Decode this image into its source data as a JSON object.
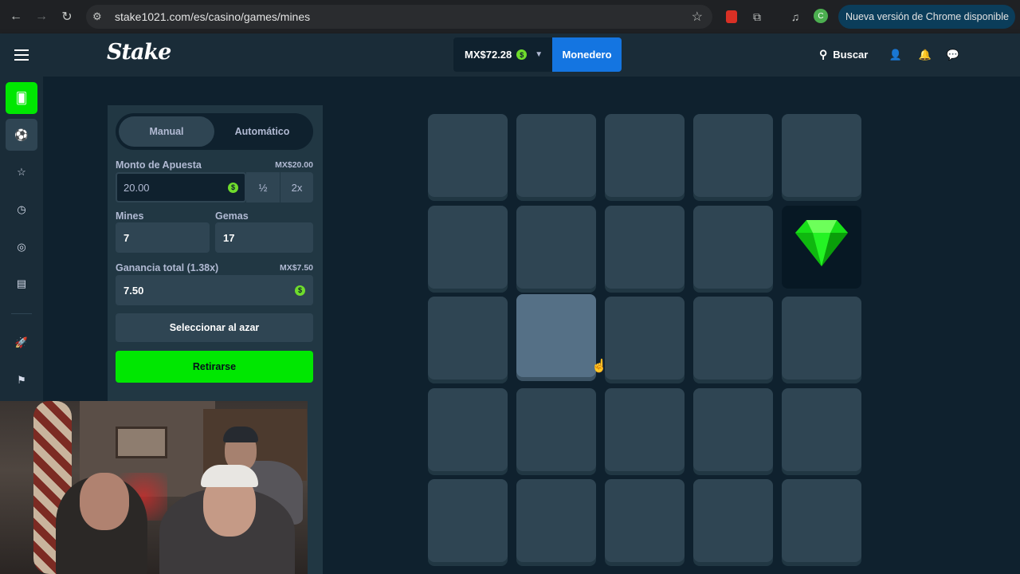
{
  "browser": {
    "url": "stake1021.com/es/casino/games/mines",
    "profile_initial": "C",
    "update_label": "Nueva versión de Chrome disponible"
  },
  "header": {
    "logo": "Stake",
    "balance": "MX$72.28",
    "wallet_label": "Monedero",
    "search_label": "Buscar"
  },
  "bet_panel": {
    "tabs": [
      {
        "label": "Manual",
        "active": true
      },
      {
        "label": "Automático",
        "active": false
      }
    ],
    "bet_amount_label": "Monto de Apuesta",
    "bet_amount_display": "MX$20.00",
    "bet_amount_value": "20.00",
    "half_label": "½",
    "double_label": "2x",
    "mines_label": "Mines",
    "mines_value": "7",
    "gems_label": "Gemas",
    "gems_value": "17",
    "profit_label": "Ganancia total (1.38x)",
    "profit_display": "MX$7.50",
    "profit_value": "7.50",
    "random_label": "Seleccionar al azar",
    "cashout_label": "Retirarse"
  },
  "board": {
    "rows": 5,
    "cols": 5,
    "revealed_gems": [
      [
        1,
        4
      ]
    ],
    "hovered": [
      2,
      1
    ]
  },
  "colors": {
    "accent_green": "#00e701",
    "wallet_blue": "#1475e1",
    "bg_dark": "#0f212e",
    "panel": "#213743",
    "tile": "#2f4553"
  }
}
